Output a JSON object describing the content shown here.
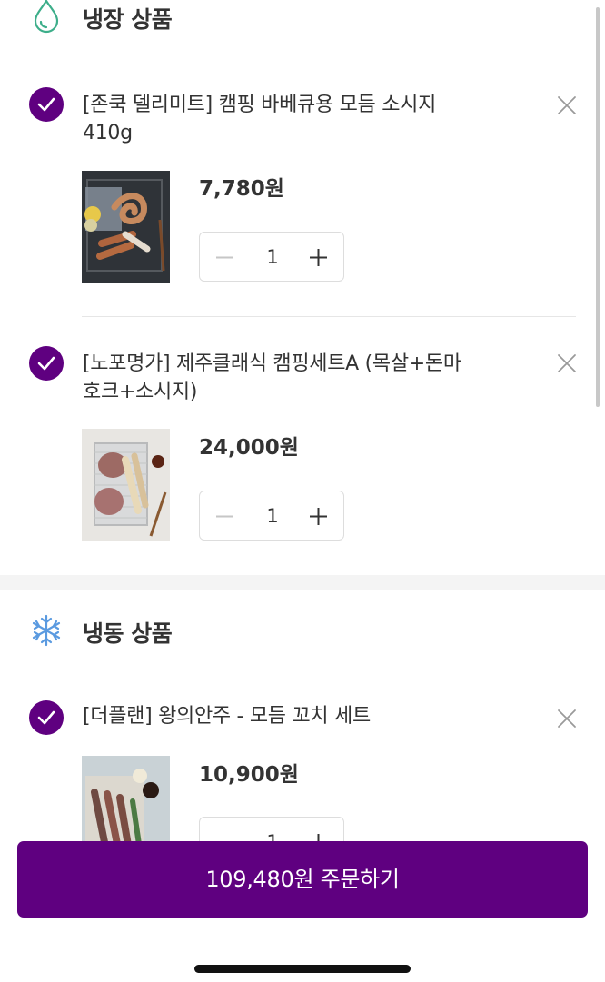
{
  "colors": {
    "accent": "#5f0080",
    "fridge_icon": "#3dae8a",
    "frozen_icon": "#5a9ae0"
  },
  "sections": [
    {
      "title": "냉장 상품",
      "icon": "water-drop-icon",
      "items": [
        {
          "name": "[존쿡 델리미트] 캠핑 바베큐용 모듬 소시지 410g",
          "price": "7,780원",
          "quantity": "1",
          "checked": true
        },
        {
          "name": "[노포명가] 제주클래식 캠핑세트A (목살+돈마호크+소시지)",
          "price": "24,000원",
          "quantity": "1",
          "checked": true
        }
      ]
    },
    {
      "title": "냉동 상품",
      "icon": "snowflake-icon",
      "items": [
        {
          "name": "[더플랜] 왕의안주 - 모듬 꼬치 세트",
          "price": "10,900원",
          "quantity": "1",
          "checked": true
        }
      ]
    }
  ],
  "order_button": {
    "label": "109,480원 주문하기"
  }
}
